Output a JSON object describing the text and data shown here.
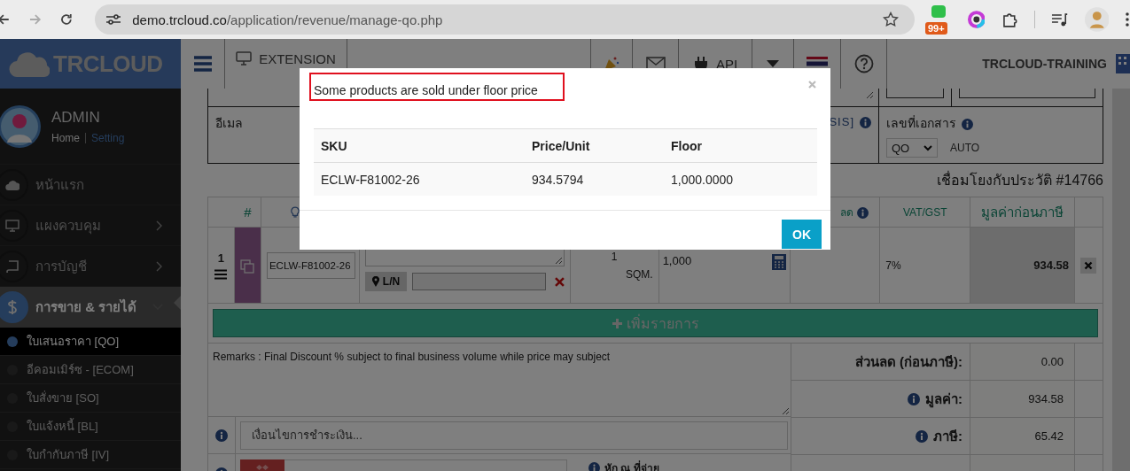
{
  "browser": {
    "url_host": "demo.trcloud.co",
    "url_path": "/application/revenue/manage-qo.php",
    "extension_badge": "99+"
  },
  "header": {
    "logo": "TRCLOUD",
    "extension": "EXTENSION",
    "api": "API",
    "company": "TRCLOUD-TRAINING"
  },
  "user": {
    "name": "ADMIN",
    "home": "Home",
    "setting": "Setting"
  },
  "sidebar": {
    "items": [
      {
        "label": "หน้าแรก",
        "selected": false
      },
      {
        "label": "แผงควบคุม",
        "expanded": false,
        "selected": false
      },
      {
        "label": "การบัญชี",
        "expanded": false,
        "selected": false
      },
      {
        "label": "การขาย & รายได้",
        "expanded": true,
        "selected": true
      }
    ],
    "sub_items": [
      {
        "label": "ใบเสนอราคา [QO]",
        "selected": true
      },
      {
        "label": "อีคอมเมิร์ซ - [ECOM]",
        "selected": false
      },
      {
        "label": "ใบสั่งขาย [SO]",
        "selected": false
      },
      {
        "label": "ใบแจ้งหนี้ [BL]",
        "selected": false
      },
      {
        "label": "ใบกำกับภาษี [IV]",
        "selected": false
      }
    ]
  },
  "form": {
    "email_label": "อีเมล",
    "partial_label": "SIS]",
    "doc_no_label": "เลขที่เอกสาร",
    "doc_prefix": "QO",
    "doc_no": "AUTO",
    "history_link": "เชื่อมโยงกับประวัติ #14766"
  },
  "items_table": {
    "col_no": "#",
    "col_discount": "ลด",
    "col_vat": "VAT/GST",
    "col_net": "มูลค่าก่อนภาษี",
    "rows": [
      {
        "no": "1",
        "sku": "ECLW-F81002-26",
        "lot_button": "L/N",
        "qty": "1",
        "unit": "SQM.",
        "price": "1,000",
        "vat": "7%",
        "net": "934.58"
      }
    ],
    "add_button": "เพิ่มรายการ"
  },
  "remarks": "Remarks : Final Discount % subject to final business volume while price may subject",
  "payment_terms_placeholder": "เงื่อนไขการชำระเงิน...",
  "withholding_label": "หัก ณ ที่จ่าย",
  "summary": [
    {
      "label": "ส่วนลด (ก่อนภาษี):",
      "value": "0.00",
      "info": false
    },
    {
      "label": "มูลค่า:",
      "value": "934.58",
      "info": true
    },
    {
      "label": "ภาษี:",
      "value": "65.42",
      "info": true
    }
  ],
  "modal": {
    "message": "Some products are sold under floor price",
    "columns": [
      "SKU",
      "Price/Unit",
      "Floor"
    ],
    "rows": [
      [
        "ECLW-F81002-26",
        "934.5794",
        "1,000.0000"
      ]
    ],
    "ok": "OK"
  }
}
